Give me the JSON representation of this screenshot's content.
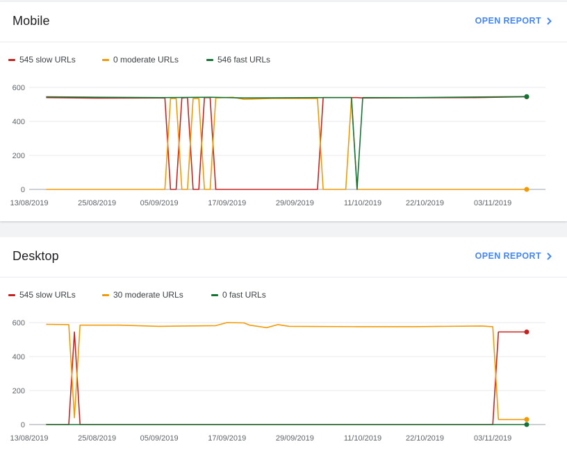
{
  "colors": {
    "slow": "#c5221f",
    "moderate": "#f29900",
    "fast": "#137333",
    "link": "#4285f4"
  },
  "mobile": {
    "title": "Mobile",
    "open_report_label": "OPEN REPORT",
    "legend": {
      "slow": "545 slow URLs",
      "moderate": "0 moderate URLs",
      "fast": "546 fast URLs"
    }
  },
  "desktop": {
    "title": "Desktop",
    "open_report_label": "OPEN REPORT",
    "legend": {
      "slow": "545 slow URLs",
      "moderate": "30 moderate URLs",
      "fast": "0 fast URLs"
    }
  },
  "chart_data": [
    {
      "type": "line",
      "title": "Mobile",
      "x_range": [
        "2019-08-13",
        "2019-11-10"
      ],
      "x_ticks": [
        "13/08/2019",
        "25/08/2019",
        "05/09/2019",
        "17/09/2019",
        "29/09/2019",
        "11/10/2019",
        "22/10/2019",
        "03/11/2019"
      ],
      "ylim": [
        0,
        600
      ],
      "y_ticks": [
        0,
        200,
        400,
        600
      ],
      "grid": true,
      "legend_position": "top-left",
      "series": [
        {
          "name": "545 slow URLs",
          "color": "#c5221f",
          "points": [
            [
              "2019-08-16",
              540
            ],
            [
              "2019-08-25",
              537
            ],
            [
              "2019-09-05",
              538
            ],
            [
              "2019-09-06",
              538
            ],
            [
              "2019-09-07",
              0
            ],
            [
              "2019-09-08",
              0
            ],
            [
              "2019-09-09",
              538
            ],
            [
              "2019-09-10",
              540
            ],
            [
              "2019-09-11",
              0
            ],
            [
              "2019-09-12",
              0
            ],
            [
              "2019-09-13",
              540
            ],
            [
              "2019-09-14",
              540
            ],
            [
              "2019-09-15",
              0
            ],
            [
              "2019-10-03",
              0
            ],
            [
              "2019-10-04",
              540
            ],
            [
              "2019-10-10",
              540
            ],
            [
              "2019-10-11",
              538
            ],
            [
              "2019-10-12",
              538
            ],
            [
              "2019-10-31",
              540
            ],
            [
              "2019-11-09",
              545
            ]
          ]
        },
        {
          "name": "0 moderate URLs",
          "color": "#f29900",
          "points": [
            [
              "2019-08-16",
              0
            ],
            [
              "2019-09-06",
              0
            ],
            [
              "2019-09-07",
              535
            ],
            [
              "2019-09-08",
              535
            ],
            [
              "2019-09-09",
              0
            ],
            [
              "2019-09-10",
              0
            ],
            [
              "2019-09-11",
              535
            ],
            [
              "2019-09-12",
              535
            ],
            [
              "2019-09-13",
              0
            ],
            [
              "2019-09-14",
              0
            ],
            [
              "2019-09-15",
              538
            ],
            [
              "2019-09-18",
              542
            ],
            [
              "2019-09-20",
              530
            ],
            [
              "2019-09-25",
              535
            ],
            [
              "2019-10-03",
              535
            ],
            [
              "2019-10-04",
              0
            ],
            [
              "2019-10-08",
              0
            ],
            [
              "2019-10-09",
              538
            ],
            [
              "2019-10-10",
              0
            ],
            [
              "2019-11-09",
              0
            ]
          ]
        },
        {
          "name": "546 fast URLs",
          "color": "#137333",
          "points": [
            [
              "2019-08-16",
              545
            ],
            [
              "2019-08-25",
              542
            ],
            [
              "2019-09-05",
              540
            ],
            [
              "2019-09-14",
              542
            ],
            [
              "2019-09-20",
              538
            ],
            [
              "2019-10-03",
              540
            ],
            [
              "2019-10-08",
              540
            ],
            [
              "2019-10-09",
              540
            ],
            [
              "2019-10-10",
              0
            ],
            [
              "2019-10-11",
              540
            ],
            [
              "2019-10-20",
              540
            ],
            [
              "2019-11-09",
              546
            ]
          ]
        }
      ]
    },
    {
      "type": "line",
      "title": "Desktop",
      "x_range": [
        "2019-08-13",
        "2019-11-10"
      ],
      "x_ticks": [
        "13/08/2019",
        "25/08/2019",
        "05/09/2019",
        "17/09/2019",
        "29/09/2019",
        "11/10/2019",
        "22/10/2019",
        "03/11/2019"
      ],
      "ylim": [
        0,
        600
      ],
      "y_ticks": [
        0,
        200,
        400,
        600
      ],
      "grid": true,
      "legend_position": "top-left",
      "series": [
        {
          "name": "545 slow URLs",
          "color": "#c5221f",
          "points": [
            [
              "2019-08-16",
              0
            ],
            [
              "2019-08-20",
              0
            ],
            [
              "2019-08-21",
              545
            ],
            [
              "2019-08-22",
              0
            ],
            [
              "2019-11-03",
              0
            ],
            [
              "2019-11-04",
              545
            ],
            [
              "2019-11-09",
              545
            ]
          ]
        },
        {
          "name": "30 moderate URLs",
          "color": "#f29900",
          "points": [
            [
              "2019-08-16",
              590
            ],
            [
              "2019-08-20",
              588
            ],
            [
              "2019-08-21",
              40
            ],
            [
              "2019-08-22",
              585
            ],
            [
              "2019-08-29",
              585
            ],
            [
              "2019-09-05",
              578
            ],
            [
              "2019-09-15",
              582
            ],
            [
              "2019-09-17",
              600
            ],
            [
              "2019-09-20",
              598
            ],
            [
              "2019-09-21",
              585
            ],
            [
              "2019-09-24",
              570
            ],
            [
              "2019-09-26",
              588
            ],
            [
              "2019-09-28",
              578
            ],
            [
              "2019-10-10",
              576
            ],
            [
              "2019-10-20",
              576
            ],
            [
              "2019-11-01",
              580
            ],
            [
              "2019-11-03",
              576
            ],
            [
              "2019-11-04",
              30
            ],
            [
              "2019-11-09",
              30
            ]
          ]
        },
        {
          "name": "0 fast URLs",
          "color": "#137333",
          "points": [
            [
              "2019-08-16",
              0
            ],
            [
              "2019-11-09",
              0
            ]
          ]
        }
      ]
    }
  ]
}
